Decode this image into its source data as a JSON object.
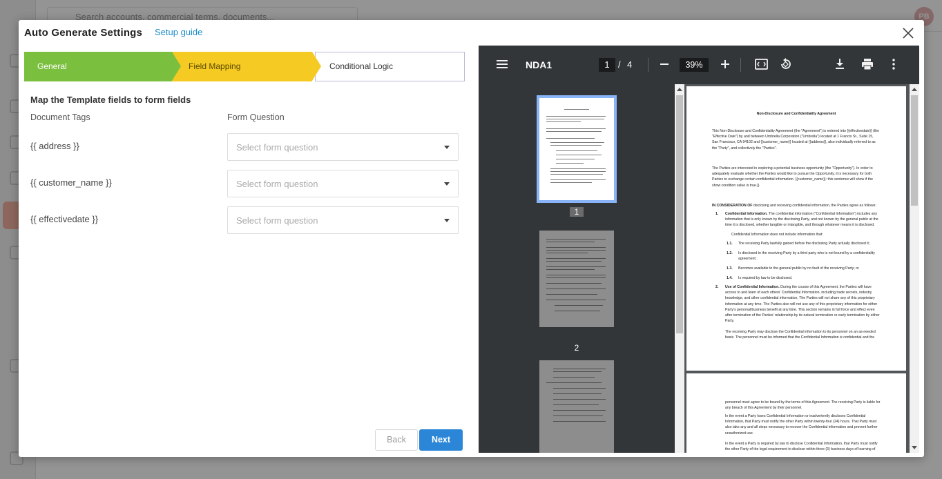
{
  "background": {
    "search_placeholder": "Search accounts, commercial terms, documents...",
    "avatar_initials": "PB"
  },
  "modal": {
    "title": "Auto Generate Settings",
    "setup_link": "Setup guide",
    "steps": [
      {
        "label": "General",
        "state": "complete",
        "color": "#7bbf3f"
      },
      {
        "label": "Field Mapping",
        "state": "active",
        "color": "#f5ca22"
      },
      {
        "label": "Conditional Logic",
        "state": "pending",
        "color": "#ffffff"
      }
    ],
    "section_title": "Map the Template fields to form fields",
    "col_tags": "Document Tags",
    "col_question": "Form Question",
    "mappings": [
      {
        "tag": "{{ address }}",
        "placeholder": "Select form question"
      },
      {
        "tag": "{{ customer_name }}",
        "placeholder": "Select form question"
      },
      {
        "tag": "{{ effectivedate }}",
        "placeholder": "Select form question"
      }
    ],
    "back_label": "Back",
    "next_label": "Next"
  },
  "pdf": {
    "title": "NDA1",
    "current_page": "1",
    "page_sep": "/",
    "total_pages": "4",
    "zoom": "39%",
    "thumb_numbers": [
      "1",
      "2"
    ],
    "page1": {
      "heading": "Non-Disclosure and Confidentiality Agreement",
      "p1": "This Non-Disclosure and Confidentiality Agreement (the \"Agreement\") is entered into {{effectivedate}} (the \"Effective Date\") by and between Umbrella Corporation (\"Umbrella\") located at 1 Francis St., Suite 15, San Francisco, CA 94102 and {{customer_name}} located at {{address}}, also individually referred to as the \"Party\", and collectively the \"Parties\".",
      "p2": "The Parties are interested in exploring a potential business opportunity (the \"Opportunity\"). In order to adequately evaluate whether the Parties would like to pursue the Opportunity, it is necessary for both Parties to exchange certain confidential information. {{customer_name}}: this sentence will show if the show condition value is true.}}",
      "p3_bold": "IN CONSIDERATION OF",
      "p3": " disclosing and receiving confidential information, the Parties agree as follows:",
      "s1_num": "1.",
      "s1_bold": "Confidential Information.",
      "s1": " The confidential information (\"Confidential Information\") includes any information that is only known by the disclosing Party, and not known by the general public at the time it is disclosed, whether tangible or intangible, and through whatever means it is disclosed.",
      "s1_sub": "Confidential Information does not include information that:",
      "s11_num": "1.1.",
      "s11": "The receiving Party lawfully gained before the disclosing Party actually disclosed it;",
      "s12_num": "1.2.",
      "s12": "Is disclosed to the receiving Party by a third party who is not bound by a confidentiality agreement;",
      "s13_num": "1.3.",
      "s13": "Becomes available to the general public by no fault of the receiving Party; or",
      "s14_num": "1.4.",
      "s14": "Is required by law to be disclosed.",
      "s2_num": "2.",
      "s2_bold": "Use of Confidential Information.",
      "s2": " During the course of this Agreement, the Parties will have access to and learn of each others' Confidential Information, including trade secrets, industry knowledge, and other confidential information. The Parties will not share any of this proprietary information at any time. The Parties also will not use any of this proprietary information for either Party's personal/business benefit at any time. This section remains in full force and effect even after termination of the Parties' relationship by its natural termination or early termination by either Party.",
      "s2b": "The receiving Party may disclose the Confidential information to its personnel on an as-needed basis. The personnel must be informed that the Confidential Information is confidential and the"
    },
    "page2": {
      "p1": "personnel must agree to be bound by the terms of this Agreement. The receiving Party is liable for any breach of this Agreement by their personnel.",
      "p2": "In the event a Party loses Confidential Information or inadvertently discloses Confidential Information, that Party must notify the other Party within twenty-four (24) hours. That Party must also take any and all steps necessary to recover the Confidential information and prevent further unauthorized use.",
      "p3": "In the event a Party is required by law to disclose Confidential Information, that Party must notify the other Party of the legal requirement to disclose within three (3) business days of learning of"
    }
  }
}
